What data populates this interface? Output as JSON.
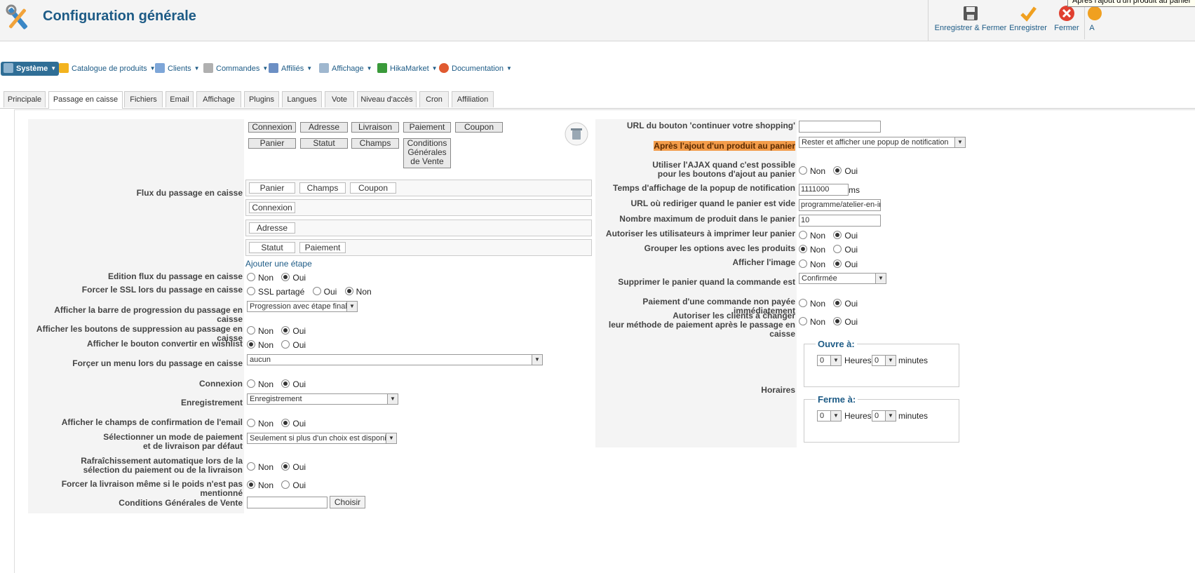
{
  "header": {
    "title": "Configuration générale",
    "toolbar": {
      "save_close": "Enregistrer & Fermer",
      "save": "Enregistrer",
      "close": "Fermer",
      "cut_label": "A"
    },
    "tooltip": "Après l'ajout d'un produit au panier"
  },
  "menu": [
    {
      "label": "Système",
      "icon": "gear-icon"
    },
    {
      "label": "Catalogue de produits",
      "icon": "folder-icon"
    },
    {
      "label": "Clients",
      "icon": "users-icon"
    },
    {
      "label": "Commandes",
      "icon": "orders-icon"
    },
    {
      "label": "Affiliés",
      "icon": "affiliates-icon"
    },
    {
      "label": "Affichage",
      "icon": "display-icon"
    },
    {
      "label": "HikaMarket",
      "icon": "market-icon"
    },
    {
      "label": "Documentation",
      "icon": "lifebuoy-icon"
    }
  ],
  "tabs": [
    "Principale",
    "Passage en caisse",
    "Fichiers",
    "Email",
    "Affichage",
    "Plugins",
    "Langues",
    "Vote",
    "Niveau d'accès",
    "Cron",
    "Affiliation"
  ],
  "left": {
    "flow_label": "Flux du passage en caisse",
    "available": [
      "Connexion",
      "Adresse",
      "Livraison",
      "Paiement",
      "Coupon",
      "Panier",
      "Statut",
      "Champs"
    ],
    "cgv_chip": [
      "Conditions",
      "Générales",
      "de Vente"
    ],
    "steps": [
      [
        "Panier",
        "Champs",
        "Coupon"
      ],
      [
        "Connexion"
      ],
      [
        "Adresse"
      ],
      [
        "Statut",
        "Paiement"
      ]
    ],
    "add_step": "Ajouter une étape",
    "rows": {
      "edit_flow": "Edition flux du passage en caisse",
      "force_ssl": "Forcer le SSL lors du passage en caisse",
      "progress_bar": "Afficher la barre de progression du passage en caisse",
      "delete_buttons": "Afficher les boutons de suppression au passage en caisse",
      "wishlist": "Afficher le bouton convertir en wishlist",
      "force_menu": "Forçer un menu lors du passage en caisse",
      "login": "Connexion",
      "registration": "Enregistrement",
      "email_confirm": "Afficher le champs de confirmation de l'email",
      "default_method_1": "Sélectionner un mode de paiement",
      "default_method_2": "et de livraison par défaut",
      "auto_refresh_1": "Rafraîchissement automatique lors de la",
      "auto_refresh_2": "sélection du paiement ou de la livraison",
      "force_shipping": "Forcer la livraison même si le poids n'est pas mentionné",
      "terms": "Conditions Générales de Vente"
    },
    "values": {
      "ssl_shared": "SSL partagé",
      "progress_select": "Progression avec étape finale",
      "menu_select": "aucun",
      "registration_select": "Enregistrement",
      "method_select": "Seulement si plus d'un choix est disponible",
      "choose_button": "Choisir",
      "terms_value": ""
    }
  },
  "right": {
    "continue_url": "URL du bouton 'continuer votre shopping'",
    "continue_url_value": "",
    "after_add": "Après l'ajout d'un produit au panier",
    "after_add_select": "Rester et afficher une popup de notification",
    "ajax_1": "Utiliser l'AJAX quand c'est possible",
    "ajax_2": "pour les boutons d'ajout au panier",
    "popup_time": "Temps d'affichage de la popup de notification",
    "popup_time_value": "1111000",
    "popup_unit": "ms",
    "empty_url": "URL où rediriger quand le panier est vide",
    "empty_url_value": "programme/atelier-en-imm",
    "max_products": "Nombre maximum de produit dans le panier",
    "max_products_value": "10",
    "print_cart": "Autoriser les utilisateurs à imprimer leur panier",
    "group_options": "Grouper les options avec les produits",
    "show_image": "Afficher l'image",
    "delete_cart": "Supprimer le panier quand la commande est",
    "delete_cart_select": "Confirmée",
    "unpaid": "Paiement d'une commande non payée immédiatement",
    "change_method_1": "Autoriser les clients à changer",
    "change_method_2": "leur méthode de paiement après le passage en caisse",
    "hours": "Horaires",
    "opens": "Ouvre à:",
    "closes": "Ferme à:",
    "hours_unit": "Heures",
    "minutes_unit": "minutes",
    "zero": "0"
  },
  "common": {
    "non": "Non",
    "oui": "Oui"
  },
  "colors": {
    "accent": "#1d5b86",
    "highlight": "#f39c4a",
    "active_menu": "#2f6e96"
  }
}
